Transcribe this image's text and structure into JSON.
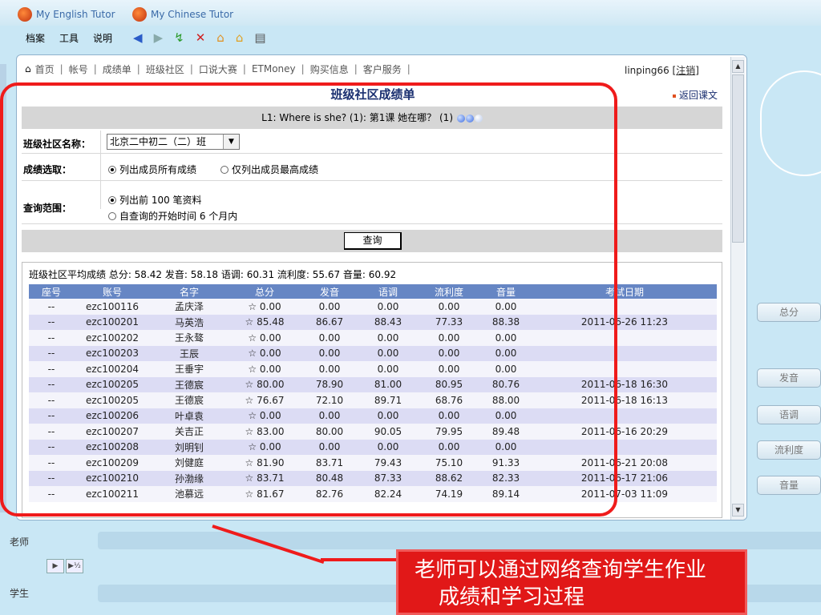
{
  "app": {
    "tab_left": "My English Tutor",
    "tab_right": "My Chinese Tutor"
  },
  "menu": [
    "档案",
    "工具",
    "说明"
  ],
  "toolbar_icons": [
    "back-icon",
    "forward-icon",
    "refresh-icon",
    "close-icon",
    "home-icon",
    "favorites-home-icon",
    "print-icon"
  ],
  "nav": {
    "items": [
      "首页",
      "帐号",
      "成绩单",
      "班级社区",
      "口说大赛",
      "ETMoney",
      "购买信息",
      "客户服务"
    ],
    "user": "linping66",
    "logout": "注销"
  },
  "page": {
    "title": "班级社区成绩单",
    "back_link": "返回课文",
    "lesson": "L1: Where is she? (1): 第1课  她在哪？ (1)"
  },
  "form": {
    "community_label": "班级社区名称：",
    "community_value": "北京二中初二（二）班",
    "score_label": "成绩选取：",
    "score_opt1": "列出成员所有成绩",
    "score_opt2": "仅列出成员最高成绩",
    "range_label": "查询范围：",
    "range_opt1": "列出前 100 笔资料",
    "range_opt2": "自查询的开始时间 6 个月内",
    "query_button": "查询"
  },
  "summary": "班级社区平均成绩  总分: 58.42  发音: 58.18  语调: 60.31  流利度: 55.67  音量: 60.92",
  "table": {
    "headers": [
      "座号",
      "账号",
      "名字",
      "总分",
      "发音",
      "语调",
      "流利度",
      "音量",
      "考试日期"
    ],
    "rows": [
      [
        "--",
        "ezc100116",
        "孟庆泽",
        "☆ 0.00",
        "0.00",
        "0.00",
        "0.00",
        "0.00",
        ""
      ],
      [
        "--",
        "ezc100201",
        "马英浩",
        "☆ 85.48",
        "86.67",
        "88.43",
        "77.33",
        "88.38",
        "2011-06-26 11:23"
      ],
      [
        "--",
        "ezc100202",
        "王永骜",
        "☆ 0.00",
        "0.00",
        "0.00",
        "0.00",
        "0.00",
        ""
      ],
      [
        "--",
        "ezc100203",
        "王辰",
        "☆ 0.00",
        "0.00",
        "0.00",
        "0.00",
        "0.00",
        ""
      ],
      [
        "--",
        "ezc100204",
        "王垂宇",
        "☆ 0.00",
        "0.00",
        "0.00",
        "0.00",
        "0.00",
        ""
      ],
      [
        "--",
        "ezc100205",
        "王德宸",
        "☆ 80.00",
        "78.90",
        "81.00",
        "80.95",
        "80.76",
        "2011-06-18 16:30"
      ],
      [
        "--",
        "ezc100205",
        "王德宸",
        "☆ 76.67",
        "72.10",
        "89.71",
        "68.76",
        "88.00",
        "2011-06-18 16:13"
      ],
      [
        "--",
        "ezc100206",
        "叶卓袁",
        "☆ 0.00",
        "0.00",
        "0.00",
        "0.00",
        "0.00",
        ""
      ],
      [
        "--",
        "ezc100207",
        "关吉正",
        "☆ 83.00",
        "80.00",
        "90.05",
        "79.95",
        "89.48",
        "2011-06-16 20:29"
      ],
      [
        "--",
        "ezc100208",
        "刘明钊",
        "☆ 0.00",
        "0.00",
        "0.00",
        "0.00",
        "0.00",
        ""
      ],
      [
        "--",
        "ezc100209",
        "刘健庭",
        "☆ 81.90",
        "83.71",
        "79.43",
        "75.10",
        "91.33",
        "2011-06-21 20:08"
      ],
      [
        "--",
        "ezc100210",
        "孙渤缘",
        "☆ 83.71",
        "80.48",
        "87.33",
        "88.62",
        "82.33",
        "2011-06-17 21:06"
      ],
      [
        "--",
        "ezc100211",
        "池慕远",
        "☆ 81.67",
        "82.76",
        "82.24",
        "74.19",
        "89.14",
        "2011-07-03 11:09"
      ]
    ]
  },
  "side_buttons": [
    "总分",
    "发音",
    "语调",
    "流利度",
    "音量"
  ],
  "bottom": {
    "teacher": "老师",
    "student": "学生"
  },
  "caption": {
    "line1": "老师可以通过网络查询学生作业",
    "line2": "成绩和学习过程"
  },
  "colors": {
    "highlight": "#ef1b1b",
    "table_header": "#6686c4",
    "background": "#1a2a8a"
  }
}
